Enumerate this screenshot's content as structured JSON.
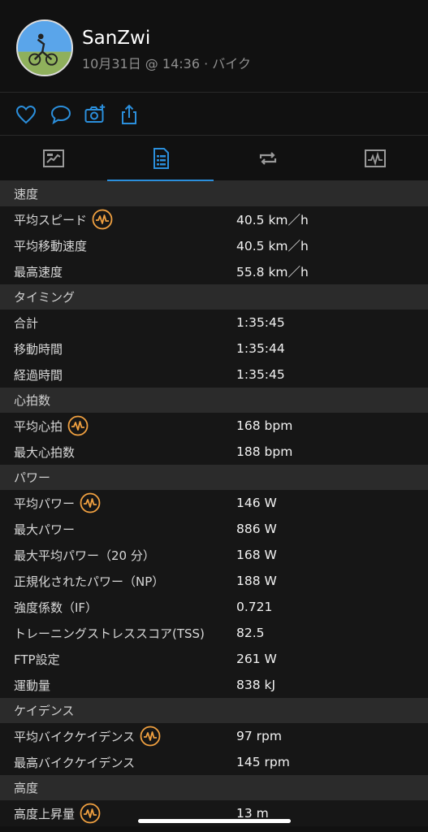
{
  "header": {
    "name": "SanZwi",
    "meta": "10月31日 @ 14:36 · バイク"
  },
  "actions": [
    {
      "icon": "heart-icon"
    },
    {
      "icon": "comment-icon"
    },
    {
      "icon": "add-photo-icon"
    },
    {
      "icon": "share-icon"
    }
  ],
  "tabs": [
    {
      "icon": "overview-icon"
    },
    {
      "icon": "stats-icon",
      "active": true
    },
    {
      "icon": "laps-icon"
    },
    {
      "icon": "chart-icon"
    }
  ],
  "sections": {
    "speed": {
      "title": "速度",
      "rows": [
        {
          "label": "平均スピード",
          "value": "40.5 km／h",
          "chart": true
        },
        {
          "label": "平均移動速度",
          "value": "40.5 km／h"
        },
        {
          "label": "最高速度",
          "value": "55.8 km／h"
        }
      ]
    },
    "timing": {
      "title": "タイミング",
      "rows": [
        {
          "label": "合計",
          "value": "1:35:45"
        },
        {
          "label": "移動時間",
          "value": "1:35:44"
        },
        {
          "label": "経過時間",
          "value": "1:35:45"
        }
      ]
    },
    "heart": {
      "title": "心拍数",
      "rows": [
        {
          "label": "平均心拍",
          "value": "168 bpm",
          "chart": true
        },
        {
          "label": "最大心拍数",
          "value": "188 bpm"
        }
      ]
    },
    "power": {
      "title": "パワー",
      "rows": [
        {
          "label": "平均パワー",
          "value": "146 W",
          "chart": true
        },
        {
          "label": "最大パワー",
          "value": "886 W"
        },
        {
          "label": "最大平均パワー（20 分）",
          "value": "168 W"
        },
        {
          "label": "正規化されたパワー（NP）",
          "value": "188 W"
        },
        {
          "label": "強度係数（IF）",
          "value": "0.721"
        },
        {
          "label": "トレーニングストレススコア(TSS)",
          "value": "82.5"
        },
        {
          "label": "FTP設定",
          "value": "261 W"
        },
        {
          "label": "運動量",
          "value": "838 kJ"
        }
      ]
    },
    "cadence": {
      "title": "ケイデンス",
      "rows": [
        {
          "label": "平均バイクケイデンス",
          "value": "97 rpm",
          "chart": true
        },
        {
          "label": "最高バイクケイデンス",
          "value": "145 rpm"
        }
      ]
    },
    "elevation": {
      "title": "高度",
      "rows": [
        {
          "label": "高度上昇量",
          "value": "13 m",
          "chart": true
        }
      ]
    }
  },
  "colors": {
    "accent": "#2b8fdc",
    "chart_badge": "#f0a040"
  }
}
